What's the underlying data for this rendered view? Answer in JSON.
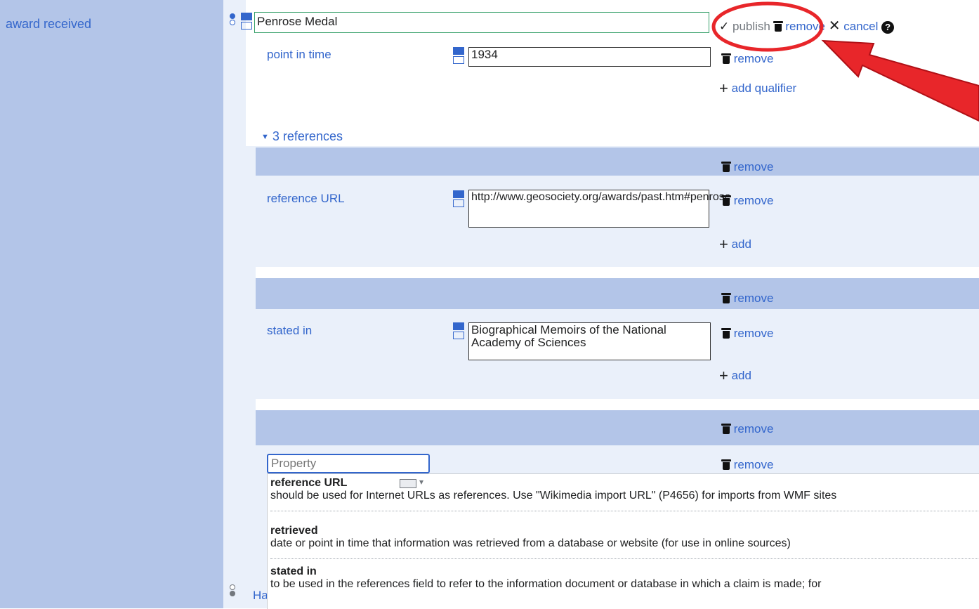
{
  "statement": {
    "property_label": "award received",
    "main_value": "Penrose Medal",
    "toolbar": {
      "publish": "publish",
      "remove": "remove",
      "cancel": "cancel",
      "help": "?"
    }
  },
  "qualifier": {
    "property": "point in time",
    "value": "1934",
    "remove": "remove",
    "add_qualifier": "add qualifier"
  },
  "references": {
    "toggle": "3 references",
    "items": [
      {
        "head_remove": "remove",
        "property": "reference URL",
        "value": "http://www.geosociety.org/awards/past.htm#penrose",
        "remove": "remove",
        "add": "add"
      },
      {
        "head_remove": "remove",
        "property": "stated in",
        "value": "Biographical Memoirs of the National Academy of Sciences",
        "remove": "remove",
        "add": "add"
      },
      {
        "head_remove": "remove",
        "property_placeholder": "Property",
        "remove": "remove"
      }
    ]
  },
  "suggestions": [
    {
      "label": "reference URL",
      "description": "should be used for Internet URLs as references. Use \"Wikimedia import URL\" (P4656) for imports from WMF sites"
    },
    {
      "label": "retrieved",
      "description": "date or point in time that information was retrieved from a database or website (for use in online sources)"
    },
    {
      "label": "stated in",
      "description": "to be used in the references field to refer to the information document or database in which a claim is made; for"
    }
  ],
  "next_statement_partial": "Ha",
  "annotation": {
    "circle_color": "#e8262a",
    "arrow_color": "#e8262a"
  },
  "colors": {
    "link": "#3366cc",
    "header_bg": "#b3c5e8",
    "body_bg": "#eaf0fa"
  }
}
